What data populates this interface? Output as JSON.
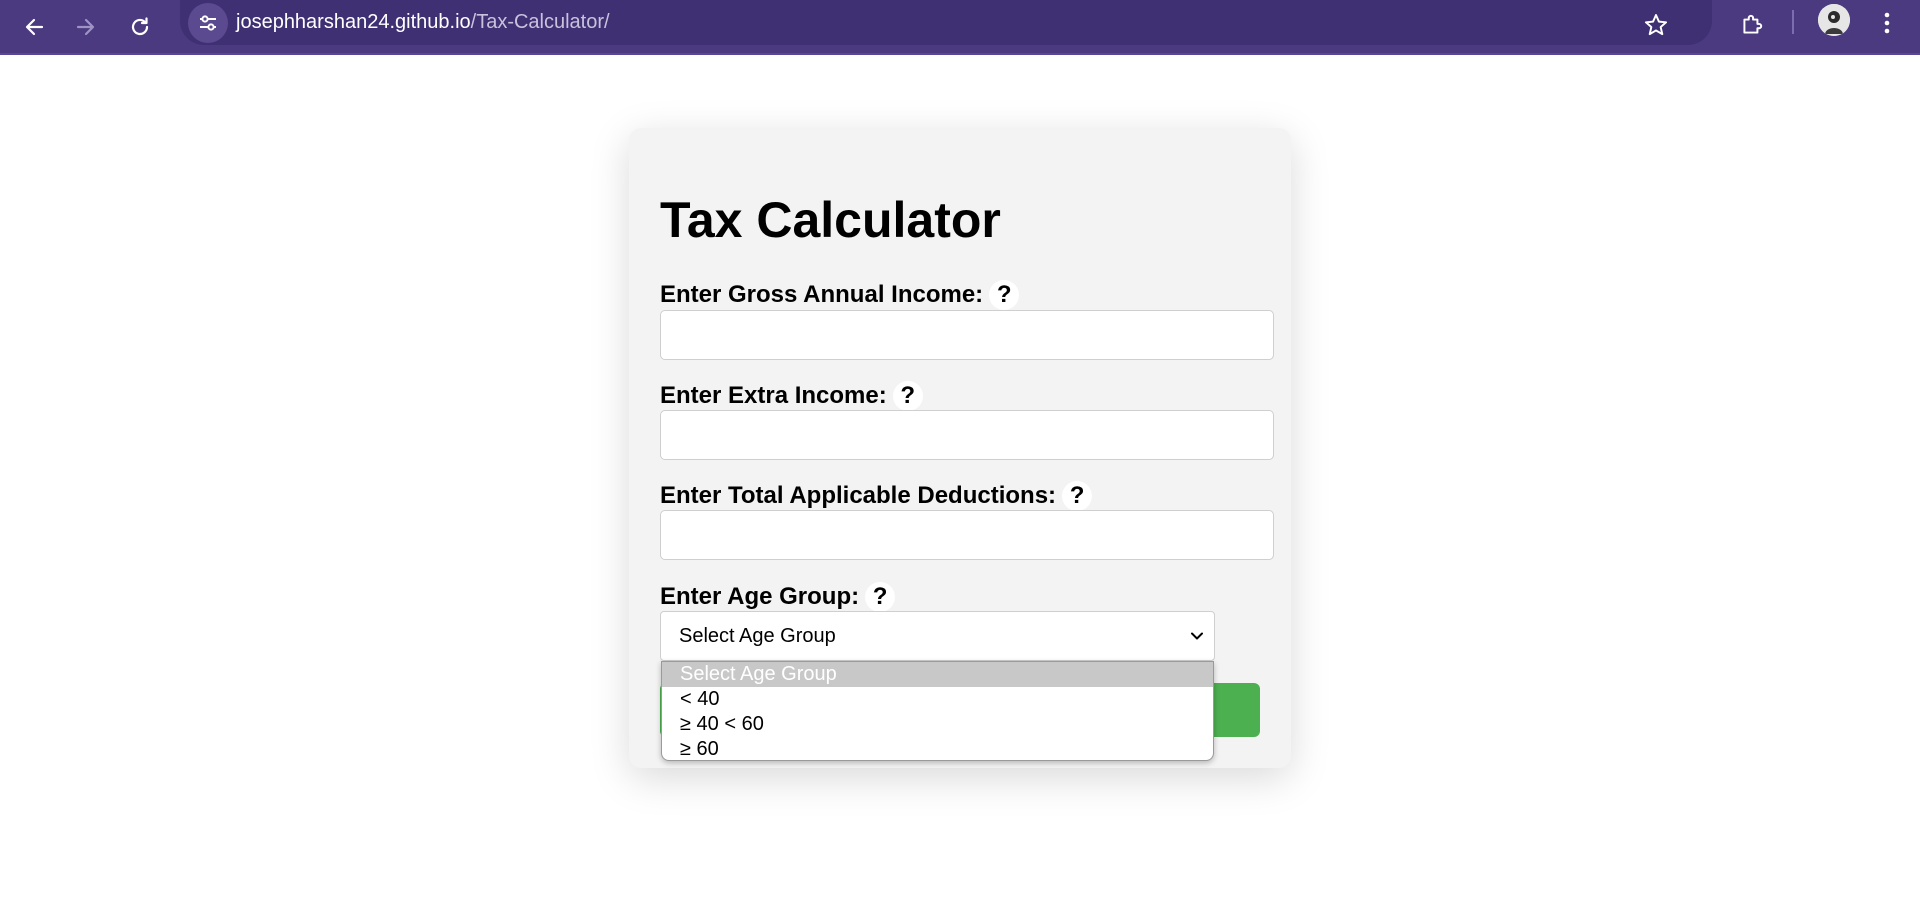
{
  "browser": {
    "url_host": "josephharshan24.github.io",
    "url_path": "/Tax-Calculator/",
    "theme_color": "#4b3a80"
  },
  "page": {
    "title": "Tax Calculator",
    "help_symbol": "?",
    "fields": [
      {
        "label": "Enter Gross Annual Income:",
        "value": ""
      },
      {
        "label": "Enter Extra Income:",
        "value": ""
      },
      {
        "label": "Enter Total Applicable Deductions:",
        "value": ""
      }
    ],
    "age": {
      "label": "Enter Age Group:",
      "selected": "Select Age Group",
      "options": [
        "Select Age Group",
        "< 40",
        "≥ 40 < 60",
        "≥ 60"
      ]
    },
    "submit_color": "#4caf50"
  }
}
